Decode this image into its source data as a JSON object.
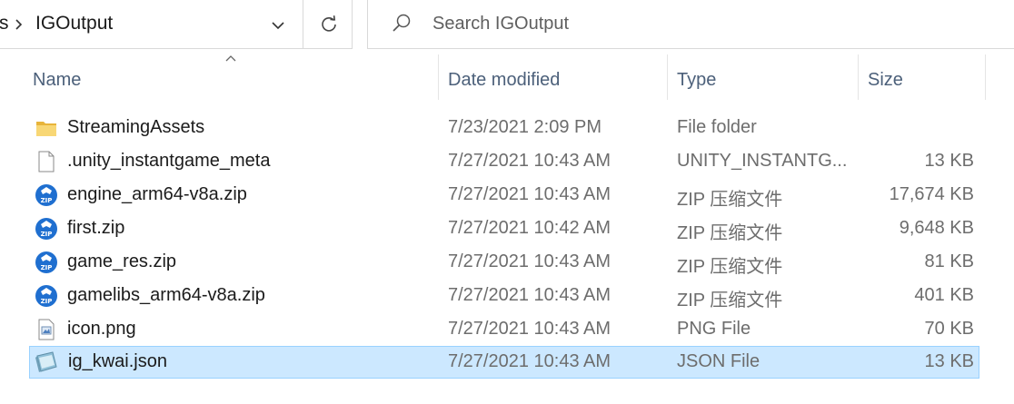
{
  "address_bar": {
    "previous_segment": "s",
    "current_folder": "IGOutput"
  },
  "search": {
    "placeholder": "Search IGOutput"
  },
  "columns": {
    "name": "Name",
    "date_modified": "Date modified",
    "type": "Type",
    "size": "Size"
  },
  "files": [
    {
      "name": "StreamingAssets",
      "date": "7/23/2021 2:09 PM",
      "type": "File folder",
      "size": "",
      "icon": "folder-icon",
      "selected": false
    },
    {
      "name": ".unity_instantgame_meta",
      "date": "7/27/2021 10:43 AM",
      "type": "UNITY_INSTANTG...",
      "size": "13 KB",
      "icon": "file-icon",
      "selected": false
    },
    {
      "name": "engine_arm64-v8a.zip",
      "date": "7/27/2021 10:43 AM",
      "type": "ZIP 压缩文件",
      "size": "17,674 KB",
      "icon": "zip-icon",
      "selected": false
    },
    {
      "name": "first.zip",
      "date": "7/27/2021 10:42 AM",
      "type": "ZIP 压缩文件",
      "size": "9,648 KB",
      "icon": "zip-icon",
      "selected": false
    },
    {
      "name": "game_res.zip",
      "date": "7/27/2021 10:43 AM",
      "type": "ZIP 压缩文件",
      "size": "81 KB",
      "icon": "zip-icon",
      "selected": false
    },
    {
      "name": "gamelibs_arm64-v8a.zip",
      "date": "7/27/2021 10:43 AM",
      "type": "ZIP 压缩文件",
      "size": "401 KB",
      "icon": "zip-icon",
      "selected": false
    },
    {
      "name": "icon.png",
      "date": "7/27/2021 10:43 AM",
      "type": "PNG File",
      "size": "70 KB",
      "icon": "image-file-icon",
      "selected": false
    },
    {
      "name": "ig_kwai.json",
      "date": "7/27/2021 10:43 AM",
      "type": "JSON File",
      "size": "13 KB",
      "icon": "json-file-icon",
      "selected": true
    }
  ],
  "colors": {
    "selection_bg": "#cce8ff",
    "selection_border": "#99d1ff",
    "header_text": "#4c607a",
    "zip_icon_blue": "#1f6fd0"
  }
}
